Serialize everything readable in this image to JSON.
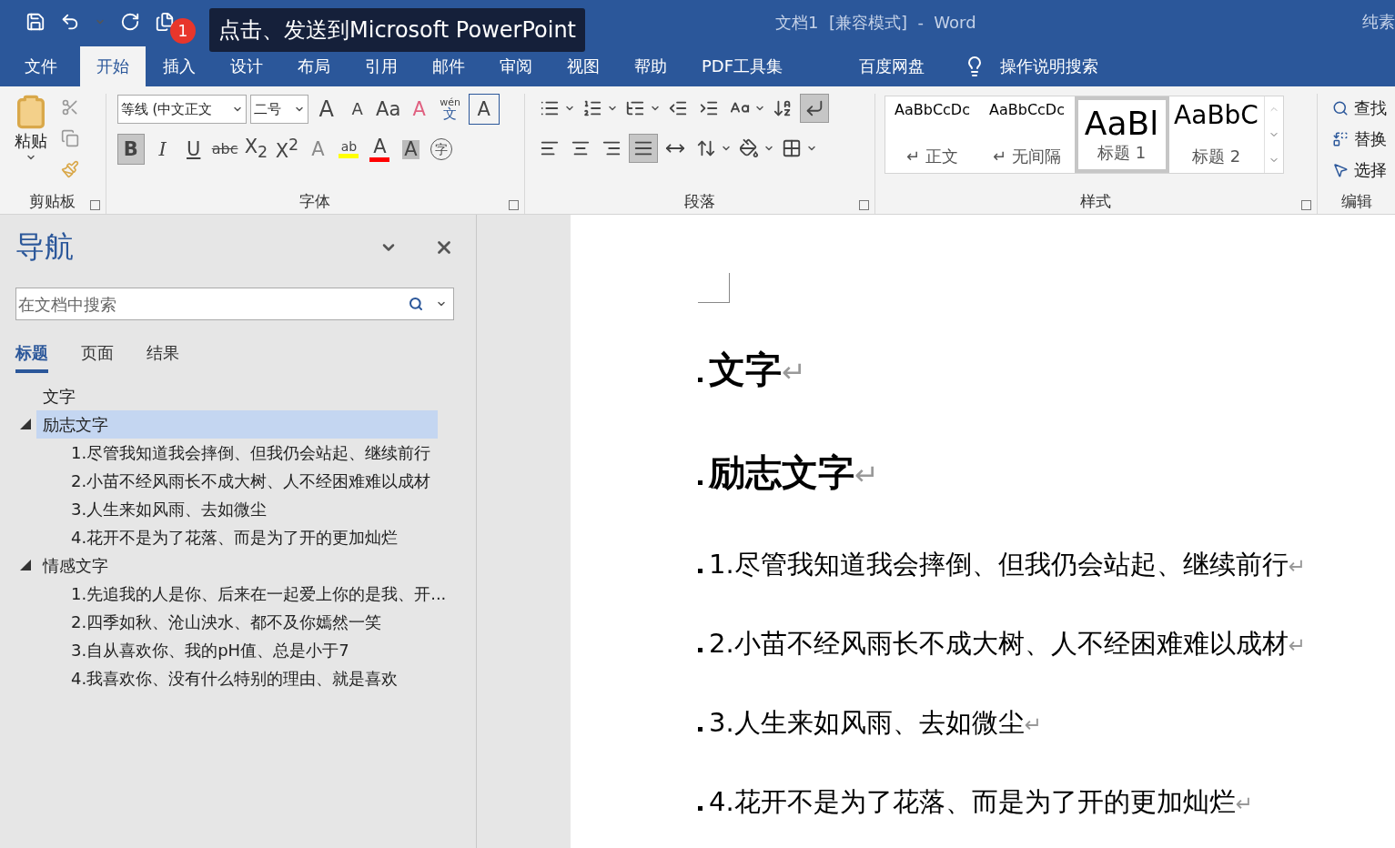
{
  "title_bar": {
    "title": "文档1  [兼容模式]  -  Word",
    "user": "纯素",
    "tooltip": "点击、发送到Microsoft PowerPoint",
    "badge": "1"
  },
  "tabs": [
    {
      "label": "文件",
      "selected": false
    },
    {
      "label": "开始",
      "selected": true
    },
    {
      "label": "插入",
      "selected": false
    },
    {
      "label": "设计",
      "selected": false
    },
    {
      "label": "布局",
      "selected": false
    },
    {
      "label": "引用",
      "selected": false
    },
    {
      "label": "邮件",
      "selected": false
    },
    {
      "label": "审阅",
      "selected": false
    },
    {
      "label": "视图",
      "selected": false
    },
    {
      "label": "帮助",
      "selected": false
    },
    {
      "label": "PDF工具集",
      "selected": false
    },
    {
      "label": "百度网盘",
      "selected": false
    }
  ],
  "tell_me": "操作说明搜索",
  "ribbon": {
    "clipboard": {
      "paste": "粘贴",
      "label": "剪贴板"
    },
    "font": {
      "name": "等线 (中文正文",
      "size": "二号",
      "label": "字体",
      "top_buttons": [
        {
          "kind": "grow",
          "label": "A"
        },
        {
          "kind": "shrink",
          "label": "A"
        },
        {
          "kind": "case",
          "label": "Aa"
        },
        {
          "kind": "clear",
          "label": "A"
        },
        {
          "kind": "phonetic",
          "label": "wén",
          "sub": "文"
        },
        {
          "kind": "border",
          "label": "A"
        }
      ],
      "bottom_buttons": [
        {
          "kind": "bold",
          "label": "B",
          "selected": true
        },
        {
          "kind": "italic",
          "label": "I",
          "selected": false
        },
        {
          "kind": "underline",
          "label": "U",
          "selected": false
        },
        {
          "kind": "strike",
          "label": "abc",
          "selected": false
        },
        {
          "kind": "subscript",
          "label": "X$_{2}$",
          "selected": false
        },
        {
          "kind": "superscript",
          "label": "X$^{2}$",
          "selected": false
        },
        {
          "kind": "effects",
          "label": "A",
          "selected": false
        },
        {
          "kind": "highlight",
          "label": "ab",
          "selected": false,
          "color": "#ffff00"
        },
        {
          "kind": "color",
          "label": "A",
          "selected": false,
          "color": "#ff0000"
        },
        {
          "kind": "shading",
          "label": "A",
          "selected": false
        },
        {
          "kind": "enclose",
          "label": "字",
          "selected": false
        }
      ]
    },
    "paragraph": {
      "label": "段落",
      "top_buttons": [
        {
          "kind": "bullets",
          "selected": false
        },
        {
          "kind": "numbering",
          "selected": false
        },
        {
          "kind": "multilevel",
          "selected": false
        },
        {
          "kind": "outdent",
          "selected": false
        },
        {
          "kind": "indent",
          "selected": false
        },
        {
          "kind": "direction",
          "selected": false
        },
        {
          "kind": "sort",
          "selected": false
        },
        {
          "kind": "marks",
          "selected": true
        }
      ],
      "bottom_buttons": [
        {
          "kind": "left",
          "selected": false
        },
        {
          "kind": "center",
          "selected": false
        },
        {
          "kind": "right",
          "selected": false
        },
        {
          "kind": "justify",
          "selected": true
        },
        {
          "kind": "distributed",
          "selected": false
        },
        {
          "kind": "spacing",
          "selected": false
        },
        {
          "kind": "fill",
          "selected": false
        },
        {
          "kind": "borders",
          "selected": false
        }
      ]
    },
    "styles": {
      "label": "样式",
      "items": [
        {
          "preview": "AaBbCcDc",
          "name": "正文",
          "mark": "↵",
          "kind": "normal",
          "selected": false
        },
        {
          "preview": "AaBbCcDc",
          "name": "无间隔",
          "mark": "↵",
          "kind": "normal",
          "selected": false
        },
        {
          "preview": "AaBl",
          "name": "标题 1",
          "kind": "heading1",
          "selected": true
        },
        {
          "preview": "AaBbC",
          "name": "标题 2",
          "kind": "heading2",
          "selected": false
        }
      ]
    },
    "editing": {
      "label": "编辑",
      "items": [
        {
          "label": "查找",
          "kind": "find"
        },
        {
          "label": "替换",
          "kind": "replace"
        },
        {
          "label": "选择",
          "kind": "select"
        }
      ]
    }
  },
  "navigation": {
    "title": "导航",
    "search": {
      "placeholder": "在文档中搜索"
    },
    "tabs": [
      {
        "label": "标题",
        "selected": true
      },
      {
        "label": "页面",
        "selected": false
      },
      {
        "label": "结果",
        "selected": false
      }
    ],
    "tree": [
      {
        "label": "文字",
        "selected": false
      },
      {
        "label": "励志文字",
        "selected": true,
        "expanded": true,
        "children": [
          {
            "label": "1.尽管我知道我会摔倒、但我仍会站起、继续前行"
          },
          {
            "label": "2.小苗不经风雨长不成大树、人不经困难难以成材"
          },
          {
            "label": "3.人生来如风雨、去如微尘"
          },
          {
            "label": "4.花开不是为了花落、而是为了开的更加灿烂"
          }
        ]
      },
      {
        "label": "情感文字",
        "selected": false,
        "expanded": true,
        "children": [
          {
            "label": "1.先追我的人是你、后来在一起爱上你的是我、开..."
          },
          {
            "label": "2.四季如秋、沧山泱水、都不及你嫣然一笑"
          },
          {
            "label": "3.自从喜欢你、我的pH值、总是小于7"
          },
          {
            "label": "4.我喜欢你、没有什么特别的理由、就是喜欢"
          }
        ]
      }
    ]
  },
  "document": {
    "paragraphs": [
      {
        "kind": "heading1",
        "text": "文字",
        "mark": "↵"
      },
      {
        "kind": "heading2",
        "text": "励志文字",
        "mark": "↵"
      },
      {
        "kind": "body",
        "text": "1.尽管我知道我会摔倒、但我仍会站起、继续前行",
        "mark": "↵"
      },
      {
        "kind": "body",
        "text": "2.小苗不经风雨长不成大树、人不经困难难以成材",
        "mark": "↵"
      },
      {
        "kind": "body",
        "text": "3.人生来如风雨、去如微尘",
        "mark": "↵"
      },
      {
        "kind": "body",
        "text": "4.花开不是为了花落、而是为了开的更加灿烂",
        "mark": "↵"
      }
    ]
  }
}
